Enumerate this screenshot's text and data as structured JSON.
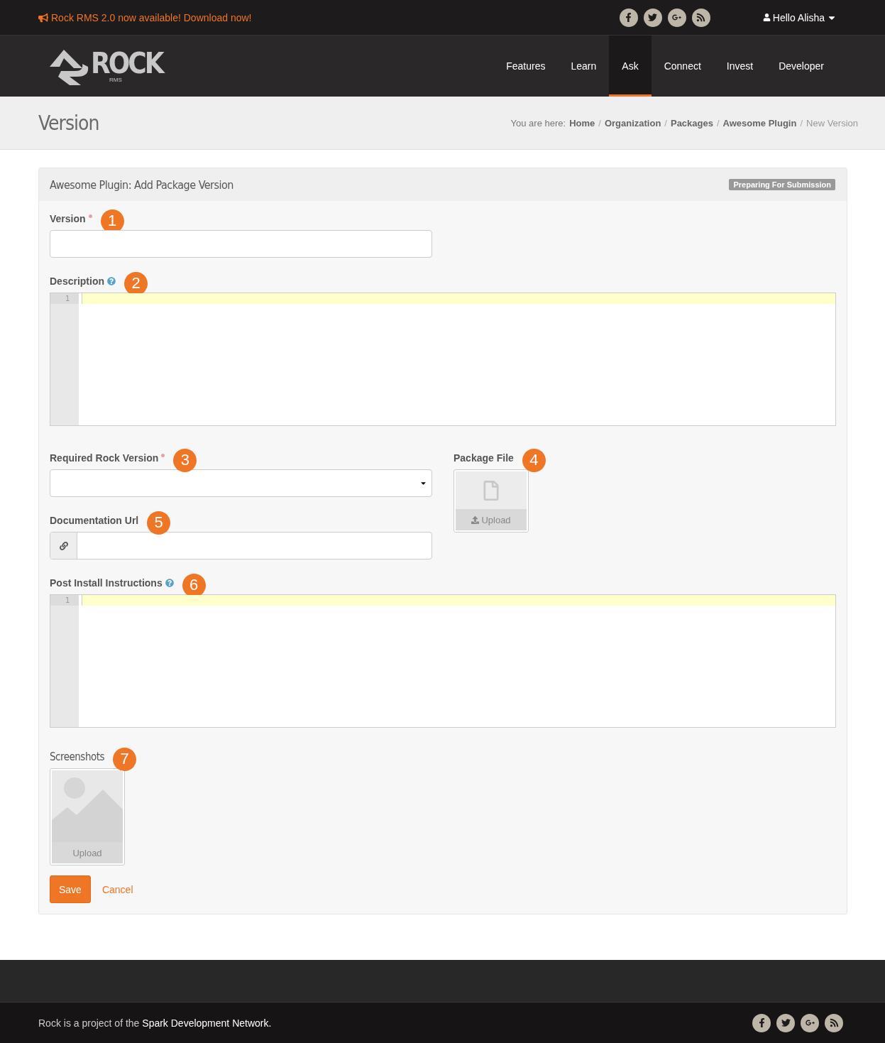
{
  "announcement": {
    "text": "Rock RMS 2.0 now available! Download now!"
  },
  "social": [
    {
      "kind": "facebook"
    },
    {
      "kind": "twitter"
    },
    {
      "kind": "googleplus"
    },
    {
      "kind": "rss"
    }
  ],
  "user_menu": {
    "label": "Hello Alisha"
  },
  "logo": {
    "text": "ROCK",
    "sub": "RMS"
  },
  "nav": [
    {
      "label": "Features",
      "selected": false
    },
    {
      "label": "Learn",
      "selected": false
    },
    {
      "label": "Ask",
      "selected": true
    },
    {
      "label": "Connect",
      "selected": false
    },
    {
      "label": "Invest",
      "selected": false
    },
    {
      "label": "Developer",
      "selected": false
    }
  ],
  "page_title": "Version",
  "breadcrumb": {
    "prefix": "You are here:",
    "separator": "/",
    "items": [
      {
        "label": "Home",
        "current": false
      },
      {
        "label": "Organization",
        "current": false
      },
      {
        "label": "Packages",
        "current": false
      },
      {
        "label": "Awesome Plugin",
        "current": false
      },
      {
        "label": "New Version",
        "current": true
      }
    ]
  },
  "panel": {
    "title": "Awesome Plugin: Add Package Version",
    "status": "Preparing For Submission",
    "fields": [
      {
        "kind": "text",
        "label": "Version",
        "required": true,
        "help": false,
        "callout": "1"
      },
      {
        "kind": "code",
        "label": "Description",
        "required": false,
        "help": true,
        "callout": "2",
        "line": "1"
      },
      {
        "kind": "select",
        "label": "Required Rock Version",
        "required": true,
        "help": false,
        "callout": "3"
      },
      {
        "kind": "url",
        "label": "Documentation Url",
        "required": false,
        "help": false,
        "callout": "5"
      },
      {
        "kind": "code",
        "label": "Post Install Instructions",
        "required": false,
        "help": true,
        "callout": "6",
        "line": "1"
      },
      {
        "label": "Screenshots",
        "required": false,
        "help": false,
        "callout": "7",
        "button": "Upload"
      }
    ],
    "side_field": {
      "kind": "file",
      "label": "Package File",
      "callout": "4",
      "button": "Upload"
    },
    "actions": {
      "save": "Save",
      "cancel": "Cancel"
    }
  },
  "footer": {
    "text": "Rock is a project of the ",
    "link": "Spark Development Network."
  }
}
